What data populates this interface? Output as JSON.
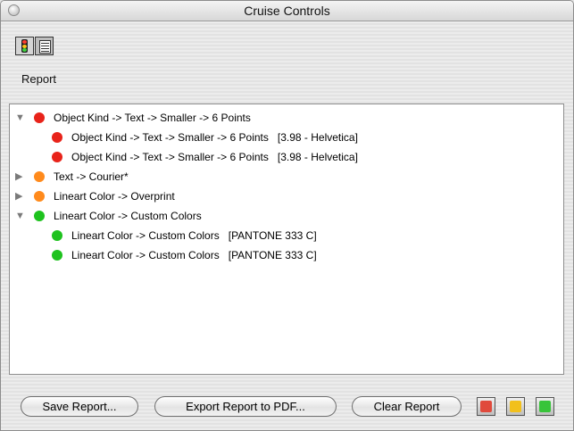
{
  "window": {
    "title": "Cruise Controls"
  },
  "toolbar": {
    "report_label": "Report"
  },
  "report": {
    "rows": [
      {
        "level": 0,
        "disclosure": "open",
        "status": "red",
        "text": "Object Kind -> Text -> Smaller -> 6 Points"
      },
      {
        "level": 1,
        "disclosure": "none",
        "status": "red",
        "text": "Object Kind -> Text -> Smaller -> 6 Points   [3.98 - Helvetica]"
      },
      {
        "level": 1,
        "disclosure": "none",
        "status": "red",
        "text": "Object Kind -> Text -> Smaller -> 6 Points   [3.98 - Helvetica]"
      },
      {
        "level": 0,
        "disclosure": "closed",
        "status": "orange",
        "text": "Text -> Courier*"
      },
      {
        "level": 0,
        "disclosure": "closed",
        "status": "orange",
        "text": "Lineart Color -> Overprint"
      },
      {
        "level": 0,
        "disclosure": "open",
        "status": "green",
        "text": "Lineart Color -> Custom Colors"
      },
      {
        "level": 1,
        "disclosure": "none",
        "status": "green",
        "text": "Lineart Color -> Custom Colors   [PANTONE 333 C]"
      },
      {
        "level": 1,
        "disclosure": "none",
        "status": "green",
        "text": "Lineart Color -> Custom Colors   [PANTONE 333 C]"
      }
    ]
  },
  "buttons": {
    "save_report": "Save Report...",
    "export_pdf": "Export Report to PDF...",
    "clear_report": "Clear Report"
  },
  "colors": {
    "red": "#e8231a",
    "orange": "#ff8a1c",
    "green": "#1ec21e",
    "filter_red": "#e04a3c",
    "filter_yellow": "#f2c01c",
    "filter_green": "#38c43a"
  }
}
